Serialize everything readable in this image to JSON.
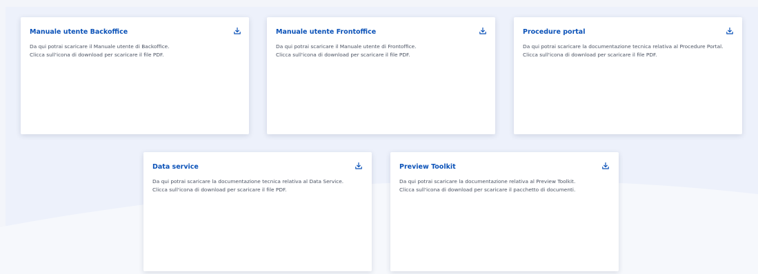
{
  "colors": {
    "accent": "#0b52b8",
    "text": "#4a5262",
    "card_bg": "#ffffff",
    "page_bg": "#f3f5fa"
  },
  "cards": [
    {
      "title": "Manuale utente Backoffice",
      "lines": [
        "Da qui potrai scaricare il Manuale utente di Backoffice.",
        "Clicca sull'icona di download per scaricare il file PDF."
      ],
      "icon": "download-icon"
    },
    {
      "title": "Manuale utente Frontoffice",
      "lines": [
        "Da qui potrai scaricare il Manuale utente di Frontoffice.",
        "Clicca sull'icona di download per scaricare il file PDF."
      ],
      "icon": "download-icon"
    },
    {
      "title": "Procedure portal",
      "lines": [
        "Da qui potrai scaricare la documentazione tecnica relativa al Procedure Portal.",
        "Clicca sull'icona di download per scaricare il file PDF."
      ],
      "icon": "download-icon"
    },
    {
      "title": "Data service",
      "lines": [
        "Da qui potrai scaricare la documentazione tecnica relativa al Data Service.",
        "Clicca sull'icona di download per scaricare il file PDF."
      ],
      "icon": "download-icon"
    },
    {
      "title": "Preview Toolkit",
      "lines": [
        "Da qui potrai scaricare la documentazione relativa al Preview Toolkit.",
        "Clicca sull'icona di download per scaricare il pacchetto di documenti."
      ],
      "icon": "download-icon"
    }
  ]
}
